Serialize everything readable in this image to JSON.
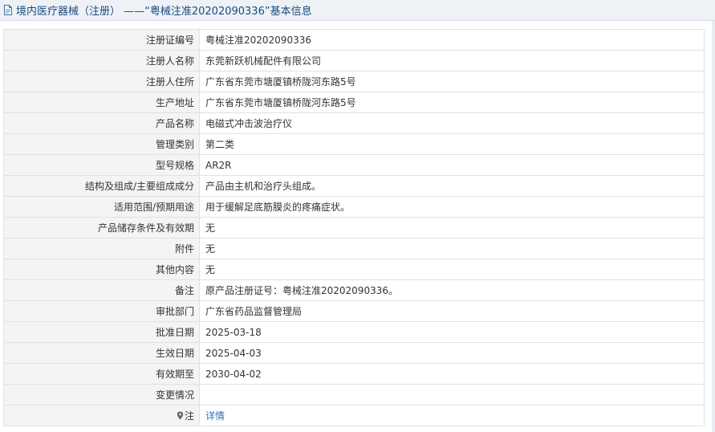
{
  "header": {
    "icon": "document-icon",
    "title": "境内医疗器械（注册） ——“粤械注准20202090336”基本信息"
  },
  "rows": [
    {
      "label": "注册证编号",
      "value": "粤械注准20202090336"
    },
    {
      "label": "注册人名称",
      "value": "东莞新跃机械配件有限公司"
    },
    {
      "label": "注册人住所",
      "value": "广东省东莞市塘厦镇桥陇河东路5号"
    },
    {
      "label": "生产地址",
      "value": "广东省东莞市塘厦镇桥陇河东路5号"
    },
    {
      "label": "产品名称",
      "value": "电磁式冲击波治疗仪"
    },
    {
      "label": "管理类别",
      "value": "第二类"
    },
    {
      "label": "型号规格",
      "value": "AR2R"
    },
    {
      "label": "结构及组成/主要组成成分",
      "value": "产品由主机和治疗头组成。"
    },
    {
      "label": "适用范围/预期用途",
      "value": "用于缓解足底筋膜炎的疼痛症状。"
    },
    {
      "label": "产品储存条件及有效期",
      "value": "无"
    },
    {
      "label": "附件",
      "value": "无"
    },
    {
      "label": "其他内容",
      "value": "无"
    },
    {
      "label": "备注",
      "value": "原产品注册证号：粤械注准20202090336。"
    },
    {
      "label": "审批部门",
      "value": "广东省药品监督管理局"
    },
    {
      "label": "批准日期",
      "value": "2025-03-18"
    },
    {
      "label": "生效日期",
      "value": "2025-04-03"
    },
    {
      "label": "有效期至",
      "value": "2030-04-02"
    },
    {
      "label": "变更情况",
      "value": ""
    }
  ],
  "note": {
    "icon": "pin-icon",
    "label": "注",
    "link_text": "详情",
    "link_color": "#2f6fc0"
  }
}
